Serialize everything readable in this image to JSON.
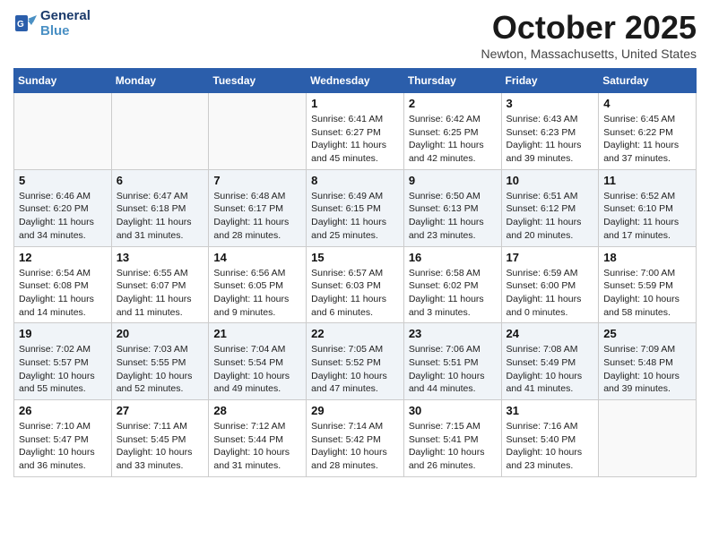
{
  "header": {
    "logo_general": "General",
    "logo_blue": "Blue",
    "month": "October 2025",
    "location": "Newton, Massachusetts, United States"
  },
  "days_of_week": [
    "Sunday",
    "Monday",
    "Tuesday",
    "Wednesday",
    "Thursday",
    "Friday",
    "Saturday"
  ],
  "weeks": [
    [
      {
        "day": "",
        "info": ""
      },
      {
        "day": "",
        "info": ""
      },
      {
        "day": "",
        "info": ""
      },
      {
        "day": "1",
        "info": "Sunrise: 6:41 AM\nSunset: 6:27 PM\nDaylight: 11 hours\nand 45 minutes."
      },
      {
        "day": "2",
        "info": "Sunrise: 6:42 AM\nSunset: 6:25 PM\nDaylight: 11 hours\nand 42 minutes."
      },
      {
        "day": "3",
        "info": "Sunrise: 6:43 AM\nSunset: 6:23 PM\nDaylight: 11 hours\nand 39 minutes."
      },
      {
        "day": "4",
        "info": "Sunrise: 6:45 AM\nSunset: 6:22 PM\nDaylight: 11 hours\nand 37 minutes."
      }
    ],
    [
      {
        "day": "5",
        "info": "Sunrise: 6:46 AM\nSunset: 6:20 PM\nDaylight: 11 hours\nand 34 minutes."
      },
      {
        "day": "6",
        "info": "Sunrise: 6:47 AM\nSunset: 6:18 PM\nDaylight: 11 hours\nand 31 minutes."
      },
      {
        "day": "7",
        "info": "Sunrise: 6:48 AM\nSunset: 6:17 PM\nDaylight: 11 hours\nand 28 minutes."
      },
      {
        "day": "8",
        "info": "Sunrise: 6:49 AM\nSunset: 6:15 PM\nDaylight: 11 hours\nand 25 minutes."
      },
      {
        "day": "9",
        "info": "Sunrise: 6:50 AM\nSunset: 6:13 PM\nDaylight: 11 hours\nand 23 minutes."
      },
      {
        "day": "10",
        "info": "Sunrise: 6:51 AM\nSunset: 6:12 PM\nDaylight: 11 hours\nand 20 minutes."
      },
      {
        "day": "11",
        "info": "Sunrise: 6:52 AM\nSunset: 6:10 PM\nDaylight: 11 hours\nand 17 minutes."
      }
    ],
    [
      {
        "day": "12",
        "info": "Sunrise: 6:54 AM\nSunset: 6:08 PM\nDaylight: 11 hours\nand 14 minutes."
      },
      {
        "day": "13",
        "info": "Sunrise: 6:55 AM\nSunset: 6:07 PM\nDaylight: 11 hours\nand 11 minutes."
      },
      {
        "day": "14",
        "info": "Sunrise: 6:56 AM\nSunset: 6:05 PM\nDaylight: 11 hours\nand 9 minutes."
      },
      {
        "day": "15",
        "info": "Sunrise: 6:57 AM\nSunset: 6:03 PM\nDaylight: 11 hours\nand 6 minutes."
      },
      {
        "day": "16",
        "info": "Sunrise: 6:58 AM\nSunset: 6:02 PM\nDaylight: 11 hours\nand 3 minutes."
      },
      {
        "day": "17",
        "info": "Sunrise: 6:59 AM\nSunset: 6:00 PM\nDaylight: 11 hours\nand 0 minutes."
      },
      {
        "day": "18",
        "info": "Sunrise: 7:00 AM\nSunset: 5:59 PM\nDaylight: 10 hours\nand 58 minutes."
      }
    ],
    [
      {
        "day": "19",
        "info": "Sunrise: 7:02 AM\nSunset: 5:57 PM\nDaylight: 10 hours\nand 55 minutes."
      },
      {
        "day": "20",
        "info": "Sunrise: 7:03 AM\nSunset: 5:55 PM\nDaylight: 10 hours\nand 52 minutes."
      },
      {
        "day": "21",
        "info": "Sunrise: 7:04 AM\nSunset: 5:54 PM\nDaylight: 10 hours\nand 49 minutes."
      },
      {
        "day": "22",
        "info": "Sunrise: 7:05 AM\nSunset: 5:52 PM\nDaylight: 10 hours\nand 47 minutes."
      },
      {
        "day": "23",
        "info": "Sunrise: 7:06 AM\nSunset: 5:51 PM\nDaylight: 10 hours\nand 44 minutes."
      },
      {
        "day": "24",
        "info": "Sunrise: 7:08 AM\nSunset: 5:49 PM\nDaylight: 10 hours\nand 41 minutes."
      },
      {
        "day": "25",
        "info": "Sunrise: 7:09 AM\nSunset: 5:48 PM\nDaylight: 10 hours\nand 39 minutes."
      }
    ],
    [
      {
        "day": "26",
        "info": "Sunrise: 7:10 AM\nSunset: 5:47 PM\nDaylight: 10 hours\nand 36 minutes."
      },
      {
        "day": "27",
        "info": "Sunrise: 7:11 AM\nSunset: 5:45 PM\nDaylight: 10 hours\nand 33 minutes."
      },
      {
        "day": "28",
        "info": "Sunrise: 7:12 AM\nSunset: 5:44 PM\nDaylight: 10 hours\nand 31 minutes."
      },
      {
        "day": "29",
        "info": "Sunrise: 7:14 AM\nSunset: 5:42 PM\nDaylight: 10 hours\nand 28 minutes."
      },
      {
        "day": "30",
        "info": "Sunrise: 7:15 AM\nSunset: 5:41 PM\nDaylight: 10 hours\nand 26 minutes."
      },
      {
        "day": "31",
        "info": "Sunrise: 7:16 AM\nSunset: 5:40 PM\nDaylight: 10 hours\nand 23 minutes."
      },
      {
        "day": "",
        "info": ""
      }
    ]
  ]
}
